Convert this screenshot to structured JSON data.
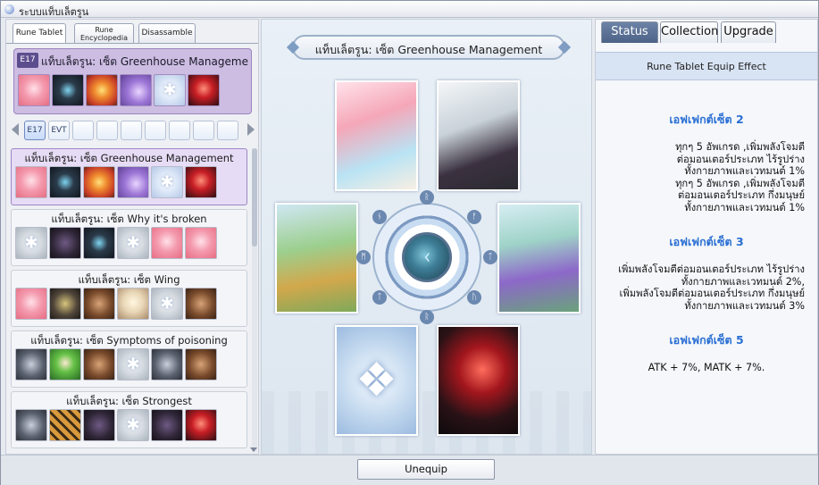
{
  "window": {
    "title": "ระบบแท็บเล็ตรูน"
  },
  "left_tabs": [
    "Rune Tablet",
    "Rune Encyclopedia",
    "Disassamble"
  ],
  "selected": {
    "badge": "E17",
    "title": "แท็บเล็ตรูน: เซ็ต Greenhouse Manageme",
    "cards": [
      "pink-fairy",
      "machine",
      "flower",
      "purple-creature",
      "empty-star",
      "red-flower"
    ]
  },
  "nav": {
    "slots": [
      "E17",
      "EVT",
      "",
      "",
      "",
      "",
      "",
      "",
      ""
    ]
  },
  "sets": [
    {
      "title": "แท็บเล็ตรูน: เซ็ต Greenhouse Management",
      "active": true,
      "cards": [
        "pink",
        "machine",
        "flower",
        "purple",
        "ice",
        "red"
      ]
    },
    {
      "title": "แท็บเล็ตรูน: เซ็ต Why it's broken",
      "active": false,
      "cards": [
        "grey",
        "dark",
        "machine",
        "grey",
        "pink",
        "pink"
      ]
    },
    {
      "title": "แท็บเล็ตรูน: เซ็ต Wing",
      "active": false,
      "cards": [
        "pink",
        "owl",
        "brown",
        "angel",
        "grey",
        "brown"
      ]
    },
    {
      "title": "แท็บเล็ตรูน: เซ็ต Symptoms of poisoning",
      "active": false,
      "cards": [
        "ghost",
        "green",
        "brown",
        "grey",
        "ghost",
        "brown"
      ]
    },
    {
      "title": "แท็บเล็ตรูน: เซ็ต Strongest",
      "active": false,
      "cards": [
        "ghost",
        "tiger",
        "dark",
        "grey",
        "dark",
        "red"
      ]
    }
  ],
  "center": {
    "title": "แท็บเล็ตรูน: เซ็ต Greenhouse Management",
    "wheel_symbol": "ᚲ"
  },
  "right_tabs": [
    "Status",
    "Collection",
    "Upgrade"
  ],
  "right_header": "Rune Tablet Equip Effect",
  "effects": [
    {
      "heading": "เอฟเฟกต์เซ็ต 2",
      "lines": [
        "ทุกๆ 5 อัพเกรด ,เพิ่มพลังโจมตี",
        "ต่อมอนเตอร์ประเภท ไร้รูปร่าง",
        "ทั้งกายภาพและเวทมนต์ 1%",
        "ทุกๆ 5 อัพเกรด ,เพิ่มพลังโจมตี",
        "ต่อมอนเตอร์ประเภท กึ่งมนุษย์",
        "ทั้งกายภาพและเวทมนต์ 1%"
      ]
    },
    {
      "heading": "เอฟเฟกต์เซ็ต 3",
      "lines": [
        "เพิ่มพลังโจมตีต่อมอนเตอร์ประเภท ไร้รูปร่าง",
        "ทั้งกายภาพและเวทมนต์ 2%,",
        "เพิ่มพลังโจมตีต่อมอนเตอร์ประเภท กึ่งมนุษย์",
        "ทั้งกายภาพและเวทมนต์ 3%"
      ]
    },
    {
      "heading": "เอฟเฟกต์เซ็ต 5",
      "lines": [
        "ATK + 7%, MATK + 7%."
      ]
    }
  ],
  "bottom": {
    "unequip_label": "Unequip"
  }
}
